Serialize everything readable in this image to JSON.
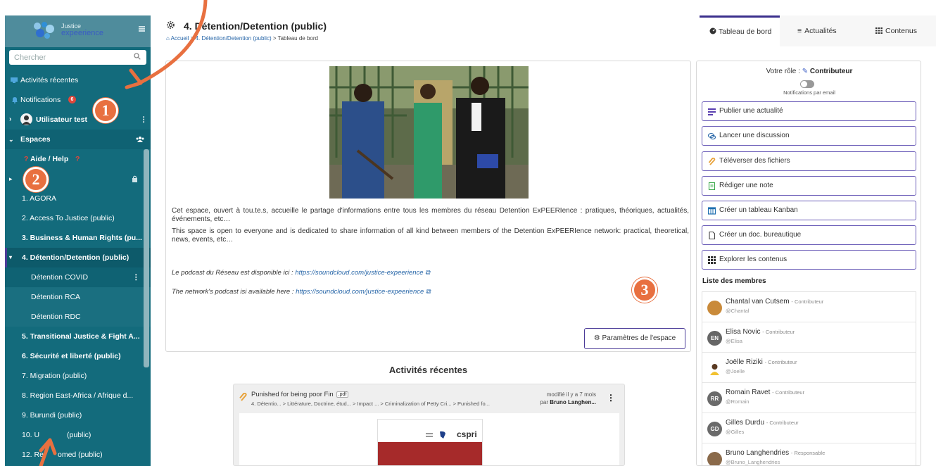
{
  "app": {
    "logo_line1": "Justice",
    "logo_line2": "expeerience"
  },
  "search": {
    "placeholder": "Chercher"
  },
  "sidebar": {
    "recent_activities": "Activités récentes",
    "notifications": "Notifications",
    "notifications_count": "6",
    "user": "Utilisateur test",
    "spaces": "Espaces",
    "help": "Aide / Help",
    "items": [
      "1. AGORA",
      "2. Access To Justice (public)",
      "3. Business & Human Rights (pu...",
      "4. Détention/Detention (public)",
      "Détention COVID",
      "Détention RCA",
      "Détention RDC",
      "5. Transitional Justice & Fight A...",
      "6. Sécurité et liberté (public)",
      "7. Migration (public)",
      "8. Region East-Africa / Afrique d...",
      "9. Burundi (public)",
      "10. U",
      "(public)",
      "12. Re",
      "omed (public)"
    ]
  },
  "header": {
    "title": "4. Détention/Detention (public)",
    "breadcrumb": [
      "Accueil",
      "4. Détention/Detention (public)",
      "Tableau de bord"
    ]
  },
  "tabs": [
    "Tableau de bord",
    "Actualités",
    "Contenus"
  ],
  "main": {
    "desc_fr": "Cet espace, ouvert à tou.te.s, accueille le partage d'informations entre tous les membres du réseau Detention ExPEERIence : pratiques, théoriques, actualités, événements, etc…",
    "desc_en": "This space is open to everyone and is dedicated to share information of all kind between members of the Detention ExPEERIence network: practical, theoretical, news, events, etc…",
    "podcast_fr_label": "Le podcast du Réseau est disponible ici : ",
    "podcast_en_label": "The network's podcast isi available here : ",
    "podcast_url": "https://soundcloud.com/justice-expeerience",
    "params_button": "Paramètres de l'espace"
  },
  "recent": {
    "title": "Activités récentes",
    "file_name": "Punished for being poor Fin",
    "file_ext": ".pdf",
    "path": "4. Détentio...  > Littérature, Doctrine, étud...  > Impact ...  > Criminalization of Petty Cri...  > Punished fo...",
    "modified": "modifié il y a 7 mois",
    "by_prefix": "par",
    "by_name": "Bruno Langhen...",
    "preview_brand": "cspri"
  },
  "right": {
    "role_prefix": "Votre rôle :",
    "role": "Contributeur",
    "email_notif": "Notifications par email",
    "actions": [
      "Publier une actualité",
      "Lancer une discussion",
      "Téléverser des fichiers",
      "Rédiger une note",
      "Créer un tableau Kanban",
      "Créer un doc. bureautique",
      "Explorer les contenus"
    ],
    "members_title": "Liste des membres",
    "members": [
      {
        "name": "Chantal van Cutsem",
        "role": "Contributeur",
        "handle": "@Chantal",
        "initials": ""
      },
      {
        "name": "Elisa Novic",
        "role": "Contributeur",
        "handle": "@Elisa",
        "initials": "EN"
      },
      {
        "name": "Joëlle Riziki",
        "role": "Contributeur",
        "handle": "@Joelle",
        "initials": ""
      },
      {
        "name": "Romain Ravet",
        "role": "Contributeur",
        "handle": "@Romain",
        "initials": "RR"
      },
      {
        "name": "Gilles Durdu",
        "role": "Contributeur",
        "handle": "@Gilles",
        "initials": "GD"
      },
      {
        "name": "Bruno Langhendries",
        "role": "Responsable",
        "handle": "@Bruno_Langhendries",
        "initials": ""
      }
    ]
  },
  "annotations": [
    "1",
    "2",
    "3"
  ],
  "colors": {
    "sidebar": "#136b7c",
    "accent": "#4b3b98",
    "annotation": "#e87040",
    "link": "#2766a8"
  }
}
